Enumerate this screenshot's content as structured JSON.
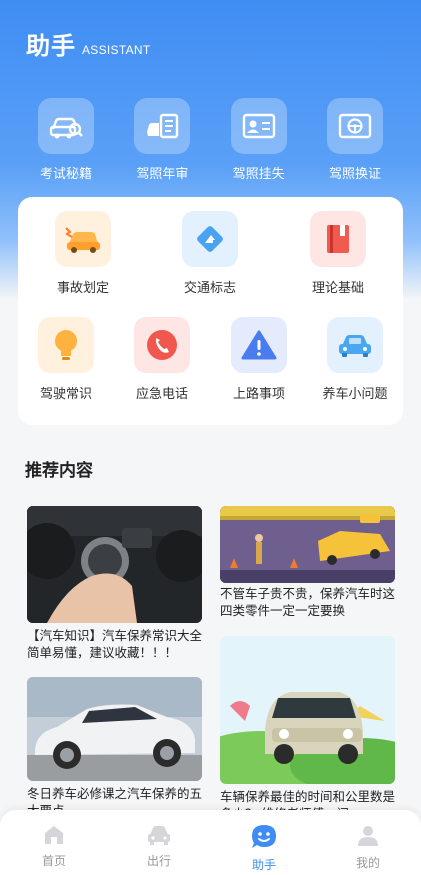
{
  "header": {
    "title": "助手",
    "subtitle": "ASSISTANT"
  },
  "top_services": [
    {
      "label": "考试秘籍",
      "icon": "car-search-icon"
    },
    {
      "label": "驾照年审",
      "icon": "license-review-icon"
    },
    {
      "label": "驾照挂失",
      "icon": "id-card-icon"
    },
    {
      "label": "驾照换证",
      "icon": "license-renew-icon"
    }
  ],
  "categories": [
    {
      "label": "事故划定",
      "icon": "car-accident-icon",
      "color": "#ffb64d"
    },
    {
      "label": "交通标志",
      "icon": "traffic-sign-icon",
      "color": "#4aa3f0"
    },
    {
      "label": "理论基础",
      "icon": "book-icon",
      "color": "#f05a4f"
    },
    {
      "label": "驾驶常识",
      "icon": "lightbulb-icon",
      "color": "#ffb23f"
    },
    {
      "label": "应急电话",
      "icon": "phone-icon",
      "color": "#f0574e"
    },
    {
      "label": "上路事项",
      "icon": "warning-icon",
      "color": "#4a7cf0"
    },
    {
      "label": "养车小问题",
      "icon": "car-icon",
      "color": "#48a6f2"
    }
  ],
  "recommend": {
    "title": "推荐内容",
    "articles": [
      {
        "text": "【汽车知识】汽车保养常识大全 简单易懂，建议收藏！！！"
      },
      {
        "text": "不管车子贵不贵，保养汽车时这四类零件一定一定要换"
      },
      {
        "text": "冬日养车必修课之汽车保养的五大要点"
      },
      {
        "text": "车辆保养最佳的时间和公里数是多少？ 维修老师傅一问"
      }
    ]
  },
  "tabbar": [
    {
      "label": "首页",
      "icon": "home-icon",
      "active": false
    },
    {
      "label": "出行",
      "icon": "car-icon",
      "active": false
    },
    {
      "label": "助手",
      "icon": "assistant-icon",
      "active": true
    },
    {
      "label": "我的",
      "icon": "user-icon",
      "active": false
    }
  ],
  "colors": {
    "primary": "#3f8df3",
    "tab_inactive": "#999999"
  }
}
